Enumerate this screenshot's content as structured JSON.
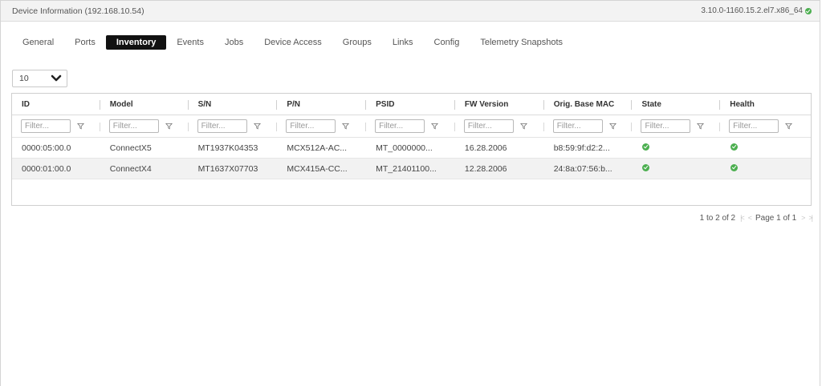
{
  "header": {
    "title": "Device Information (192.168.10.54)",
    "version": "3.10.0-1160.15.2.el7.x86_64"
  },
  "tabs": [
    {
      "label": "General"
    },
    {
      "label": "Ports"
    },
    {
      "label": "Inventory",
      "active": true
    },
    {
      "label": "Events"
    },
    {
      "label": "Jobs"
    },
    {
      "label": "Device Access"
    },
    {
      "label": "Groups"
    },
    {
      "label": "Links"
    },
    {
      "label": "Config"
    },
    {
      "label": "Telemetry Snapshots"
    }
  ],
  "page_size": {
    "value": "10"
  },
  "table": {
    "columns": [
      "ID",
      "Model",
      "S/N",
      "P/N",
      "PSID",
      "FW Version",
      "Orig. Base MAC",
      "State",
      "Health"
    ],
    "filter_placeholder": "Filter...",
    "rows": [
      {
        "id": "0000:05:00.0",
        "model": "ConnectX5",
        "sn": "MT1937K04353",
        "pn": "MCX512A-AC...",
        "psid": "MT_0000000...",
        "fw": "16.28.2006",
        "mac": "b8:59:9f:d2:2...",
        "state": "ok",
        "health": "ok"
      },
      {
        "id": "0000:01:00.0",
        "model": "ConnectX4",
        "sn": "MT1637X07703",
        "pn": "MCX415A-CC...",
        "psid": "MT_21401100...",
        "fw": "12.28.2006",
        "mac": "24:8a:07:56:b...",
        "state": "ok",
        "health": "ok"
      }
    ]
  },
  "pager": {
    "range": "1 to 2 of 2",
    "page": "Page 1 of 1"
  },
  "colors": {
    "accent_active_tab": "#111111",
    "status_ok": "#4caf50"
  },
  "icons": {
    "status": "check-circle-icon",
    "filter": "funnel-icon",
    "dropdown": "chevron-down-icon"
  }
}
